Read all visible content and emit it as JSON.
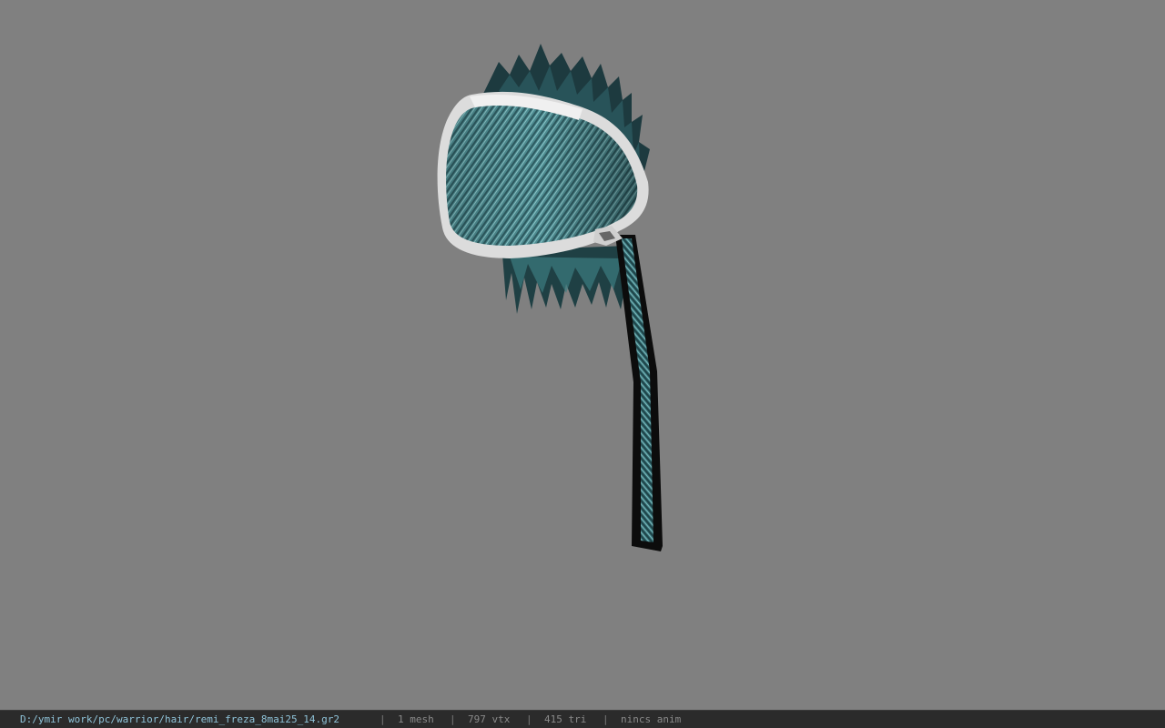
{
  "viewport": {
    "background_color": "#808080",
    "model_name": "hair-mesh"
  },
  "status_bar": {
    "file_path": "D:/ymir work/pc/warrior/hair/remi_freza_8mai25_14.gr2",
    "separator": "|",
    "mesh_count": "1 mesh",
    "vertex_count": "797 vtx",
    "triangle_count": "415 tri",
    "anim_status": "nincs anim",
    "path_color": "#8fc3d9",
    "text_color": "#8a8a8a"
  }
}
